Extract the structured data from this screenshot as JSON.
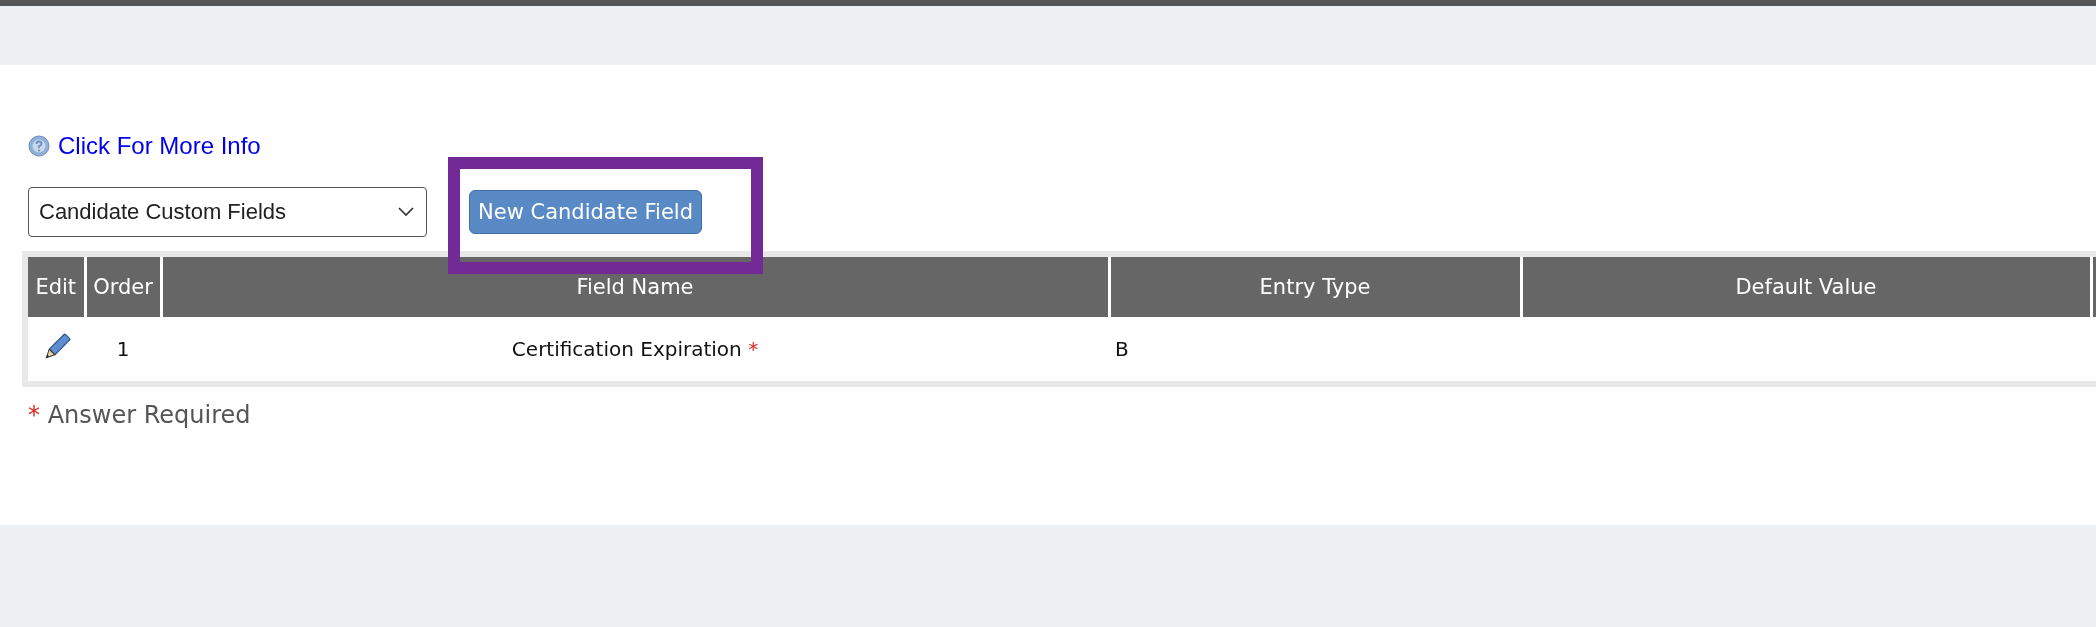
{
  "info_link": "Click For More Info",
  "field_set_select": {
    "value": "Candidate Custom Fields"
  },
  "new_button": {
    "label": "New Candidate Field",
    "highlighted": true
  },
  "table": {
    "columns": [
      "Edit",
      "Order",
      "Field Name",
      "Entry Type",
      "Default Value"
    ],
    "rows": [
      {
        "order": "1",
        "field_name": "Certification Expiration",
        "required": true,
        "entry_type": "B",
        "default_value": ""
      }
    ]
  },
  "legend": {
    "mark": "*",
    "text": "Answer Required"
  }
}
